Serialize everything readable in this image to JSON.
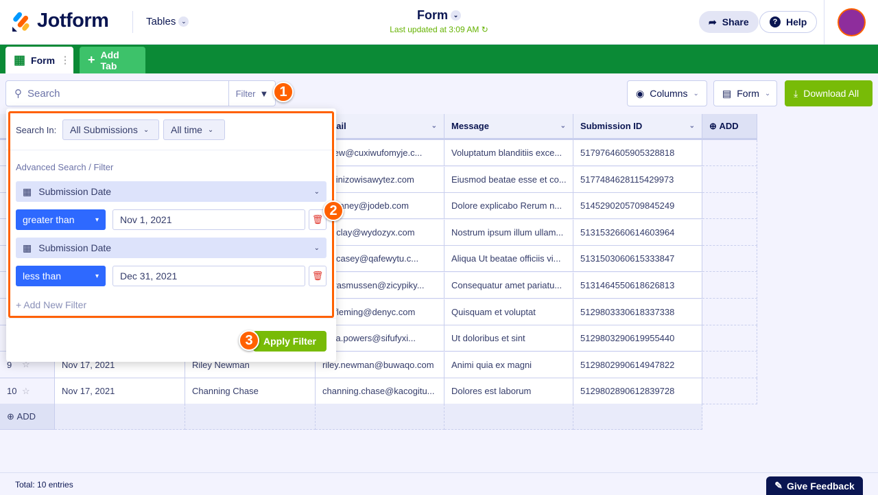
{
  "header": {
    "brand": "Jotform",
    "product": "Tables",
    "title": "Form",
    "last_updated": "Last updated at 3:09 AM",
    "share": "Share",
    "help": "Help"
  },
  "tabs": {
    "form": "Form",
    "add": "Add Tab"
  },
  "toolbar": {
    "search_placeholder": "Search",
    "filter": "Filter",
    "columns": "Columns",
    "form": "Form",
    "download": "Download All"
  },
  "colors": {
    "accent": "#0b8a36",
    "highlight": "#ff6100",
    "primary": "#2e69ff",
    "download": "#78bb07"
  },
  "table": {
    "headers": [
      "",
      "",
      "Email",
      "Message",
      "Submission ID"
    ],
    "add_col": "ADD",
    "add_row": "ADD",
    "rows": [
      {
        "n": "",
        "date": "",
        "name": "",
        "email": "ojifew@cuxiwufomyje.c...",
        "msg": "Voluptatum blanditiis exce...",
        "id": "5179764605905328818"
      },
      {
        "n": "",
        "date": "",
        "name": "",
        "email": "@zinizowisawytez.com",
        "msg": "Eiusmod beatae esse et co...",
        "id": "5177484628115429973"
      },
      {
        "n": "",
        "date": "",
        "name": "",
        "email": "yn.haney@jodeb.com",
        "msg": "Dolore explicabo Rerum n...",
        "id": "5145290205709845249"
      },
      {
        "n": "",
        "date": "",
        "name": "",
        "email": "ica.clay@wydozyx.com",
        "msg": "Nostrum ipsum illum ullam...",
        "id": "5131532660614603964"
      },
      {
        "n": "",
        "date": "",
        "name": "",
        "email": "rity.casey@qafewytu.c...",
        "msg": "Aliqua Ut beatae officiis vi...",
        "id": "5131503060615333847"
      },
      {
        "n": "",
        "date": "",
        "name": "",
        "email": "oy.rasmussen@zicypiky...",
        "msg": "Consequatur amet pariatu...",
        "id": "5131464550618626813"
      },
      {
        "n": "",
        "date": "",
        "name": "",
        "email": "se.fleming@denyc.com",
        "msg": "Quisquam et voluptat",
        "id": "5129803330618337338"
      },
      {
        "n": "",
        "date": "",
        "name": "",
        "email": "elica.powers@sifufyxi...",
        "msg": "Ut doloribus et sint",
        "id": "5129803290619955440"
      },
      {
        "n": "9",
        "date": "Nov 17, 2021",
        "name": "Riley Newman",
        "email": "riley.newman@buwaqo.com",
        "msg": "Animi quia ex magni",
        "id": "5129802990614947822"
      },
      {
        "n": "10",
        "date": "Nov 17, 2021",
        "name": "Channing Chase",
        "email": "channing.chase@kacogitu...",
        "msg": "Dolores est laborum",
        "id": "5129802890612839728"
      }
    ]
  },
  "filter": {
    "search_in_label": "Search In:",
    "scope": "All Submissions",
    "time": "All time",
    "advanced_label": "Advanced Search / Filter",
    "rules": [
      {
        "field": "Submission Date",
        "operator": "greater than",
        "value": "Nov 1, 2021"
      },
      {
        "field": "Submission Date",
        "operator": "less than",
        "value": "Dec 31, 2021"
      }
    ],
    "add_filter": "+ Add New Filter",
    "apply": "Apply Filter"
  },
  "badges": [
    "1",
    "2",
    "3"
  ],
  "footer": {
    "total": "Total: 10 entries",
    "feedback": "Give Feedback"
  }
}
